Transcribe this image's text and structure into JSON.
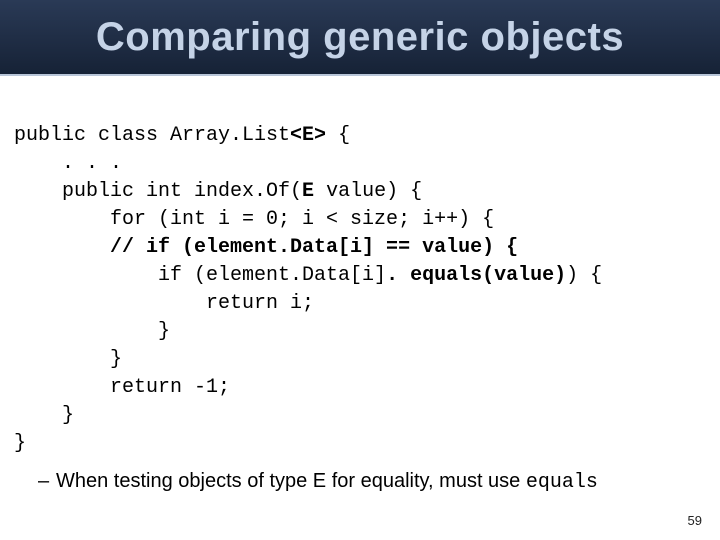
{
  "title": "Comparing generic objects",
  "code": {
    "l1a": "public class Array.List",
    "l1b": "<E>",
    "l1c": " {",
    "l2": "    . . .",
    "l3a": "    public int index.Of(",
    "l3b": "E",
    "l3c": " value) {",
    "l4": "        for (int i = 0; i < size; i++) {",
    "l5": "        // if (element.Data[i] == value) {",
    "l6a": "            if (element.Data[i]",
    "l6b": ". equals(value)",
    "l6c": ") {",
    "l7": "                return i;",
    "l8": "            }",
    "l9": "        }",
    "l10": "        return -1;",
    "l11": "    }",
    "l12": "}"
  },
  "bullet": {
    "dash": "–",
    "text1": "When testing objects of type E for equality, must use ",
    "code": "equals"
  },
  "page": "59"
}
